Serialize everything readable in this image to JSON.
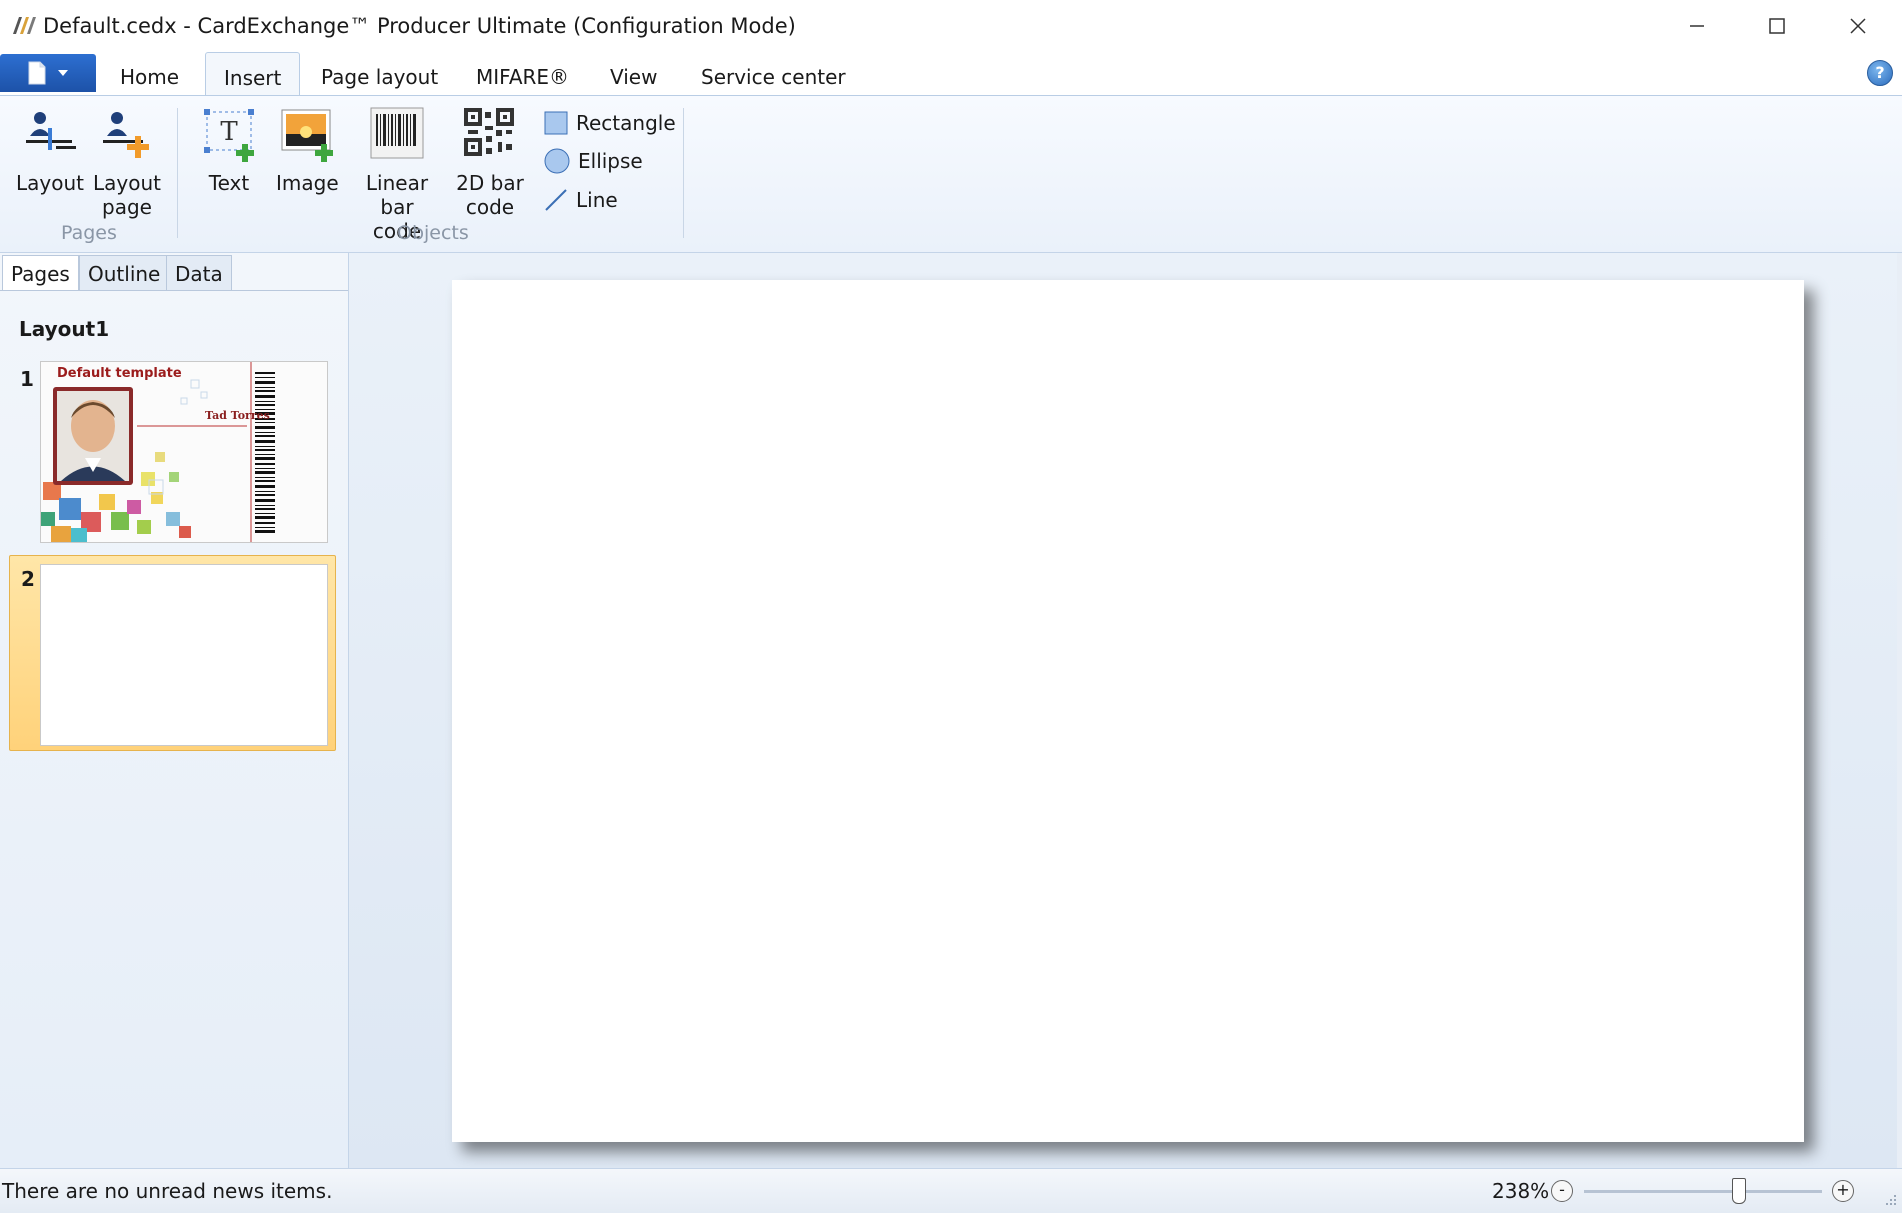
{
  "window": {
    "title": "Default.cedx - CardExchange™ Producer Ultimate (Configuration Mode)"
  },
  "ribbon_tabs": [
    {
      "label": "Home"
    },
    {
      "label": "Insert",
      "active": true
    },
    {
      "label": "Page layout"
    },
    {
      "label": "MIFARE®"
    },
    {
      "label": "View"
    },
    {
      "label": "Service center"
    }
  ],
  "ribbon": {
    "pages_group": {
      "label": "Pages",
      "layout_label": "Layout",
      "layout_page_label_1": "Layout",
      "layout_page_label_2": "page"
    },
    "objects_group": {
      "label": "Objects",
      "text_label": "Text",
      "image_label": "Image",
      "linear_label_1": "Linear bar",
      "linear_label_2": "code",
      "twod_label_1": "2D bar",
      "twod_label_2": "code",
      "rectangle_label": "Rectangle",
      "ellipse_label": "Ellipse",
      "line_label": "Line"
    }
  },
  "left_panel": {
    "tabs": [
      {
        "label": "Pages",
        "active": true
      },
      {
        "label": "Outline"
      },
      {
        "label": "Data"
      }
    ],
    "layout_title": "Layout1",
    "pages": [
      {
        "number": "1",
        "template_title": "Default template",
        "name": "Tad Torres"
      },
      {
        "number": "2",
        "selected": true
      }
    ]
  },
  "status": {
    "message": "There are no unread news items.",
    "zoom": "238%",
    "zoom_level_fraction": 0.65
  },
  "colors": {
    "accent": "#1d52a8",
    "selection": "#ffd27a",
    "template_title": "#9b1c1c"
  }
}
